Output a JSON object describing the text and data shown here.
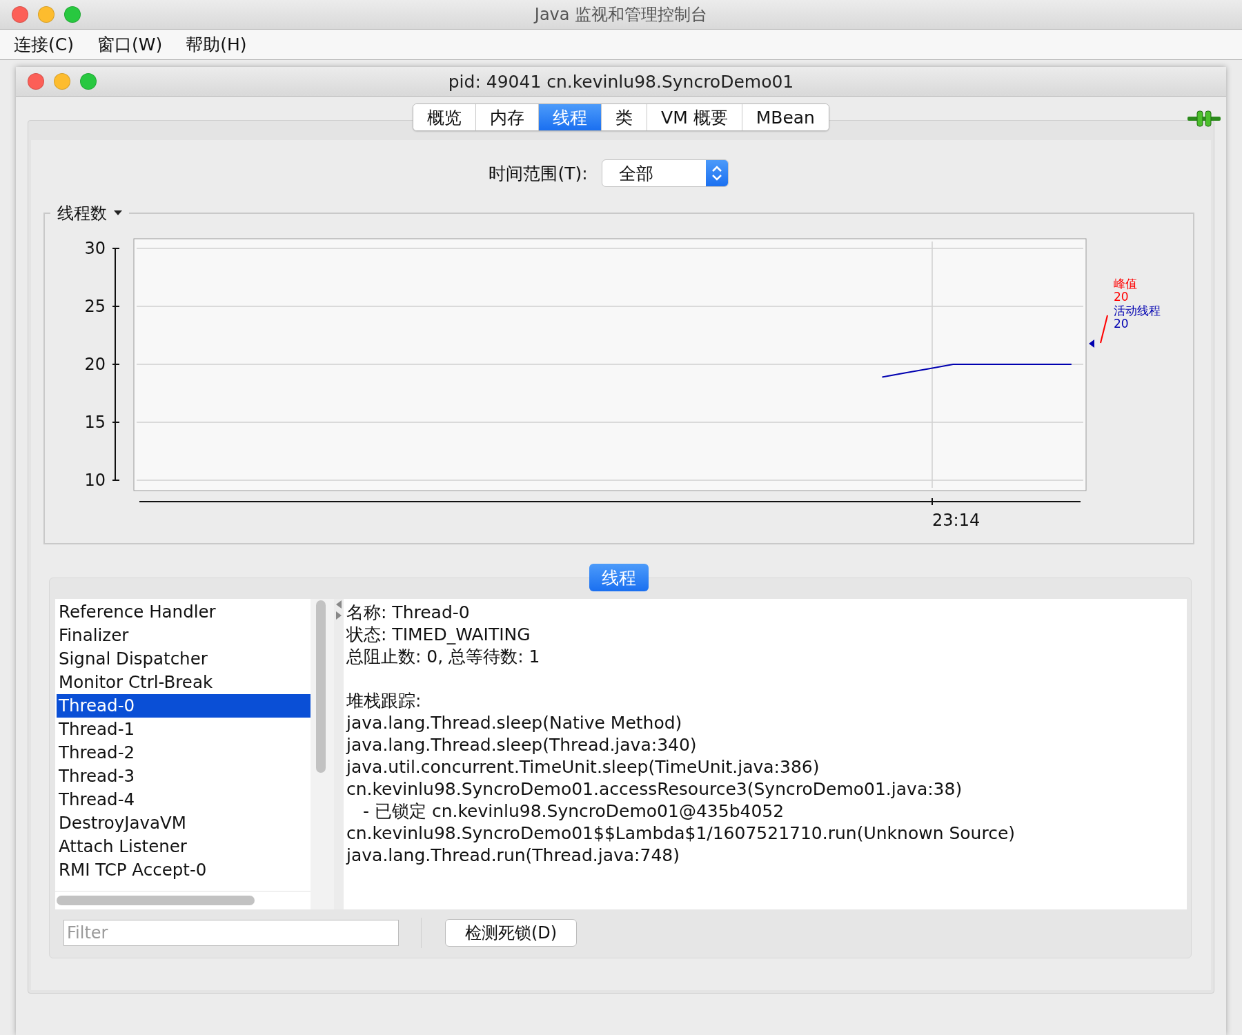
{
  "app_window": {
    "title": "Java 监视和管理控制台"
  },
  "menu": [
    {
      "label": "连接(C)"
    },
    {
      "label": "窗口(W)"
    },
    {
      "label": "帮助(H)"
    }
  ],
  "connection_window": {
    "title": "pid: 49041 cn.kevinlu98.SyncroDemo01"
  },
  "tabs": [
    {
      "label": "概览",
      "selected": false
    },
    {
      "label": "内存",
      "selected": false
    },
    {
      "label": "线程",
      "selected": true
    },
    {
      "label": "类",
      "selected": false
    },
    {
      "label": "VM 概要",
      "selected": false
    },
    {
      "label": "MBean",
      "selected": false
    }
  ],
  "time_range": {
    "label": "时间范围(T):",
    "value": "全部"
  },
  "thread_count_chart": {
    "title": "线程数",
    "chart_data": {
      "type": "line",
      "grid": true,
      "ylim": [
        10,
        30
      ],
      "yticks": [
        {
          "value": 10,
          "label": "10"
        },
        {
          "value": 15,
          "label": "15"
        },
        {
          "value": 20,
          "label": "20"
        },
        {
          "value": 25,
          "label": "25"
        },
        {
          "value": 30,
          "label": "30"
        }
      ],
      "series": [
        {
          "name": "活动线程",
          "color": "#0000b0",
          "values": [
            null,
            null,
            null,
            null,
            null,
            null,
            null,
            null,
            null,
            null,
            null,
            null,
            null,
            null,
            null,
            null,
            null,
            null,
            null,
            null,
            null,
            null,
            null,
            null,
            null,
            null,
            null,
            null,
            null,
            null,
            null,
            18.9,
            19.27,
            19.63,
            20,
            20,
            20,
            20,
            20,
            20
          ]
        }
      ],
      "annotations": [
        "23:14"
      ]
    },
    "peak": {
      "label": "峰值",
      "value": "20",
      "color": "#ff0000"
    },
    "current_value": "20"
  },
  "threads_section": {
    "title": "线程",
    "threads": [
      {
        "name": "Reference Handler",
        "selected": false
      },
      {
        "name": "Finalizer",
        "selected": false
      },
      {
        "name": "Signal Dispatcher",
        "selected": false
      },
      {
        "name": "Monitor Ctrl-Break",
        "selected": false
      },
      {
        "name": "Thread-0",
        "selected": true
      },
      {
        "name": "Thread-1",
        "selected": false
      },
      {
        "name": "Thread-2",
        "selected": false
      },
      {
        "name": "Thread-3",
        "selected": false
      },
      {
        "name": "Thread-4",
        "selected": false
      },
      {
        "name": "DestroyJavaVM",
        "selected": false
      },
      {
        "name": "Attach Listener",
        "selected": false
      },
      {
        "name": "RMI TCP Accept-0",
        "selected": false
      }
    ],
    "details": [
      {
        "kind": "field",
        "text": "名称: Thread-0"
      },
      {
        "kind": "field",
        "text": "状态: TIMED_WAITING"
      },
      {
        "kind": "field",
        "text": "总阻止数: 0, 总等待数: 1"
      },
      {
        "kind": "gap"
      },
      {
        "kind": "field",
        "text": "堆栈跟踪:"
      },
      {
        "kind": "frame",
        "text": "java.lang.Thread.sleep(Native Method)"
      },
      {
        "kind": "frame",
        "text": "java.lang.Thread.sleep(Thread.java:340)"
      },
      {
        "kind": "frame",
        "text": "java.util.concurrent.TimeUnit.sleep(TimeUnit.java:386)"
      },
      {
        "kind": "frame",
        "text": "cn.kevinlu98.SyncroDemo01.accessResource3(SyncroDemo01.java:38)"
      },
      {
        "kind": "lock",
        "text": "- 已锁定 cn.kevinlu98.SyncroDemo01@435b4052"
      },
      {
        "kind": "frame",
        "text": "cn.kevinlu98.SyncroDemo01$$Lambda$1/1607521710.run(Unknown Source)"
      },
      {
        "kind": "frame",
        "text": "java.lang.Thread.run(Thread.java:748)"
      }
    ],
    "filter": {
      "placeholder": "Filter"
    },
    "detect_button": {
      "label": "检测死锁(D)"
    }
  }
}
